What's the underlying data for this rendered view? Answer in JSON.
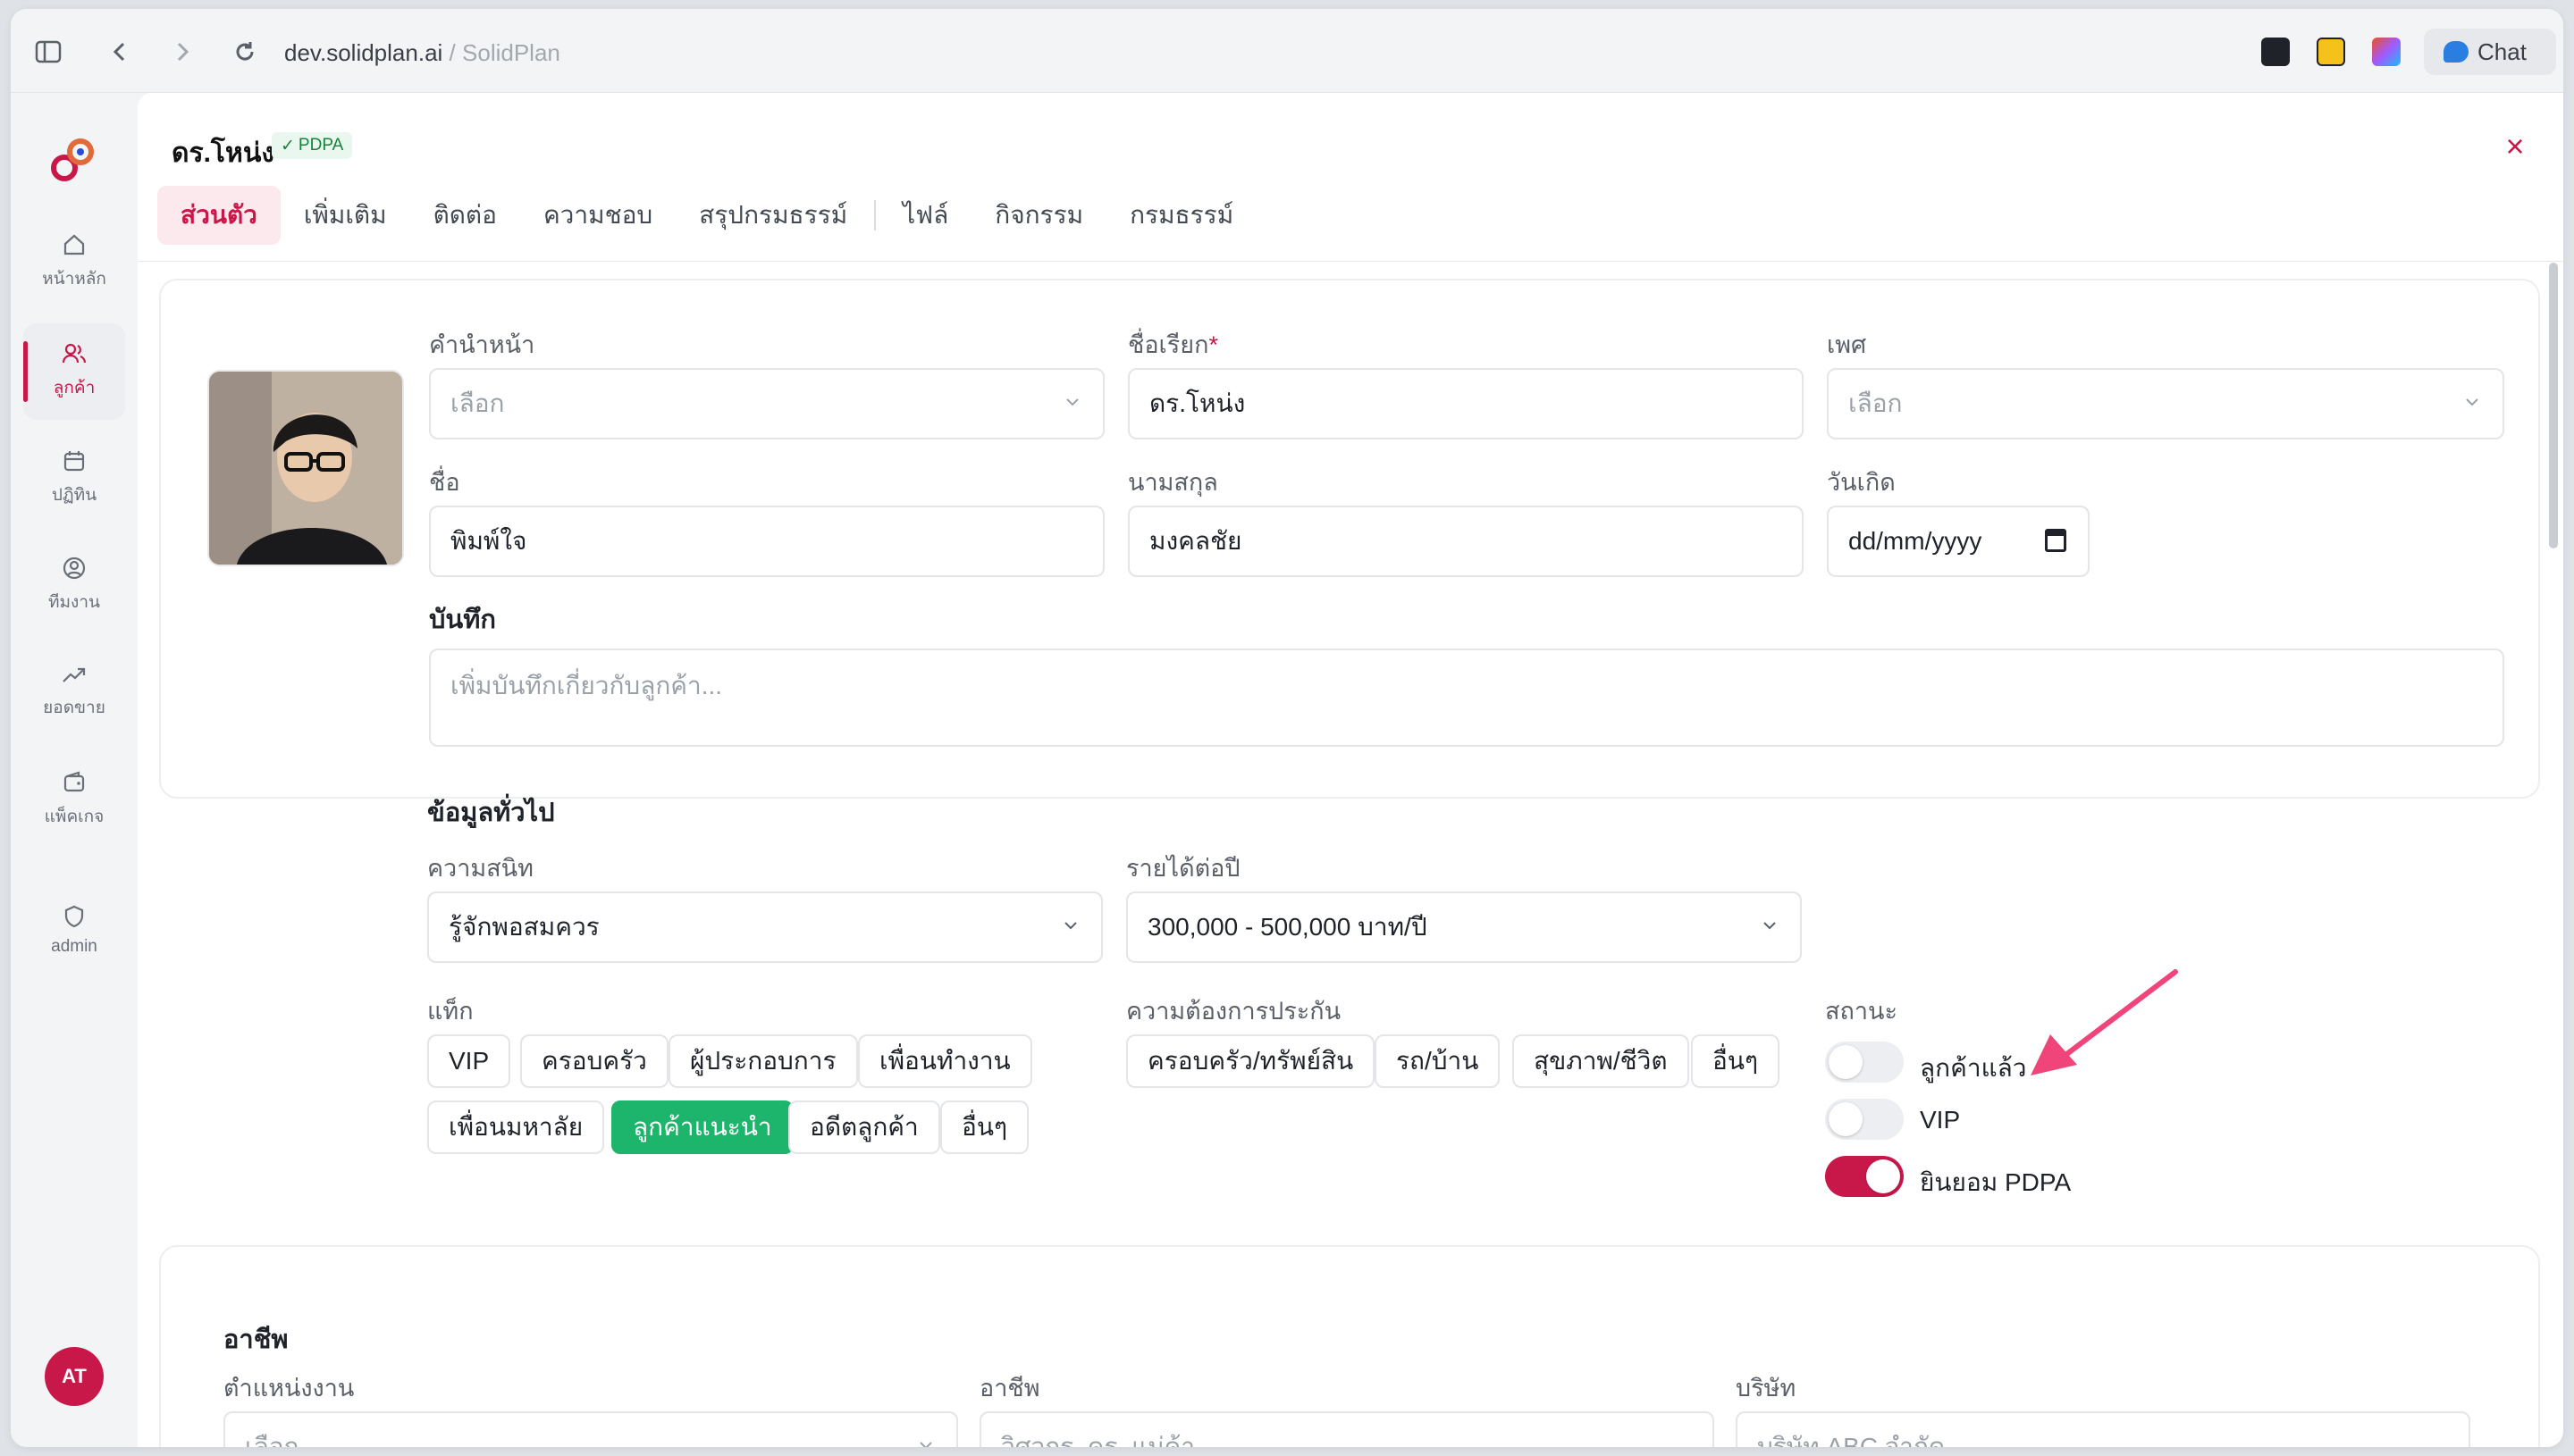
{
  "browser": {
    "url_domain": "dev.solidplan.ai",
    "url_separator": "/",
    "page_title": "SolidPlan",
    "chat_label": "Chat"
  },
  "sidebar": {
    "items": [
      {
        "label": "หน้าหลัก",
        "icon": "home-icon"
      },
      {
        "label": "ลูกค้า",
        "icon": "users-icon",
        "active": true
      },
      {
        "label": "ปฏิทิน",
        "icon": "calendar-icon"
      },
      {
        "label": "ทีมงาน",
        "icon": "team-icon"
      },
      {
        "label": "ยอดขาย",
        "icon": "trend-icon"
      },
      {
        "label": "แพ็คเกจ",
        "icon": "wallet-icon"
      },
      {
        "label": "admin",
        "icon": "shield-icon"
      }
    ],
    "avatar_initials": "AT"
  },
  "header": {
    "name": "ดร.โหน่ง",
    "badge": "PDPA"
  },
  "tabs": [
    "ส่วนตัว",
    "เพิ่มเติม",
    "ติดต่อ",
    "ความชอบ",
    "สรุปกรมธรรม์",
    "ไฟล์",
    "กิจกรรม",
    "กรมธรรม์"
  ],
  "personal": {
    "prefix_label": "คำนำหน้า",
    "prefix_placeholder": "เลือก",
    "nickname_label": "ชื่อเรียก",
    "nickname_required": "*",
    "nickname_value": "ดร.โหน่ง",
    "gender_label": "เพศ",
    "gender_placeholder": "เลือก",
    "first_name_label": "ชื่อ",
    "first_name_value": "พิมพ์ใจ",
    "last_name_label": "นามสกุล",
    "last_name_value": "มงคลชัย",
    "birthday_label": "วันเกิด",
    "birthday_placeholder": "dd/mm/yyyy",
    "note_label": "บันทึก",
    "note_placeholder": "เพิ่มบันทึกเกี่ยวกับลูกค้า..."
  },
  "general": {
    "section_title": "ข้อมูลทั่วไป",
    "closeness_label": "ความสนิท",
    "closeness_value": "รู้จักพอสมควร",
    "income_label": "รายได้ต่อปี",
    "income_value": "300,000 - 500,000 บาท/ปี",
    "tags_label": "แท็ก",
    "tags": [
      "VIP",
      "ครอบครัว",
      "ผู้ประกอบการ",
      "เพื่อนทำงาน",
      "เพื่อนมหาลัย",
      "ลูกค้าแนะนำ",
      "อดีตลูกค้า",
      "อื่นๆ"
    ],
    "selected_tag": "ลูกค้าแนะนำ",
    "needs_label": "ความต้องการประกัน",
    "needs": [
      "ครอบครัว/ทรัพย์สิน",
      "รถ/บ้าน",
      "สุขภาพ/ชีวิต",
      "อื่นๆ"
    ],
    "status_label": "สถานะ",
    "status_toggles": [
      {
        "label": "ลูกค้าแล้ว",
        "on": false
      },
      {
        "label": "VIP",
        "on": false
      },
      {
        "label": "ยินยอม PDPA",
        "on": true
      }
    ]
  },
  "career": {
    "section_title": "อาชีพ",
    "position_label": "ตำแหน่งงาน",
    "position_placeholder": "เลือก",
    "occupation_label": "อาชีพ",
    "occupation_placeholder": "วิศวกร, ครู, แม่ค้า",
    "company_label": "บริษัท",
    "company_placeholder": "บริษัท ABC จำกัด"
  },
  "colors": {
    "accent": "#c8184a",
    "selected_tag": "#1db56b",
    "annotation_arrow": "#f0457a"
  }
}
